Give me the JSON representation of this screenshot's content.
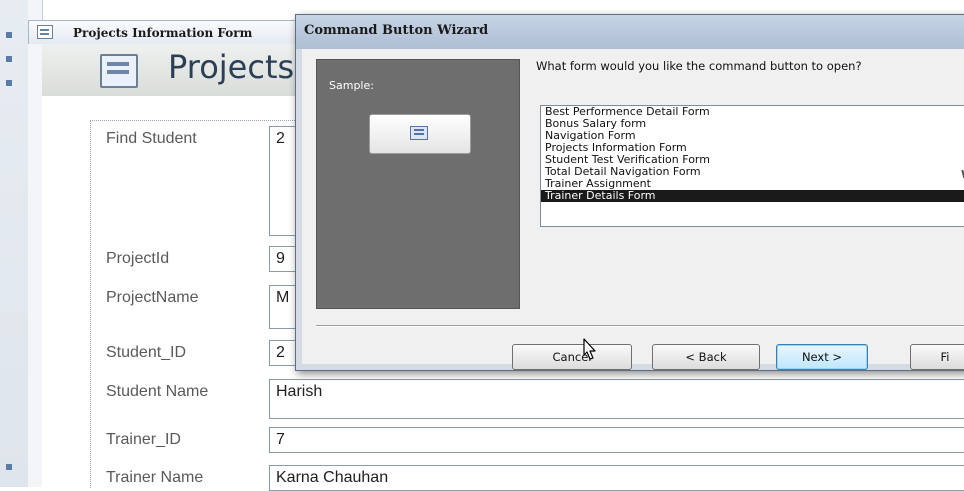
{
  "document_tab": {
    "title": "Projects Information Form"
  },
  "form": {
    "title": "Projects Information Form",
    "fields": [
      {
        "label": "Find Student",
        "value": "2"
      },
      {
        "label": "ProjectId",
        "value": "9"
      },
      {
        "label": "ProjectName",
        "value": "M"
      },
      {
        "label": "Student_ID",
        "value": "2"
      },
      {
        "label": "Student Name",
        "value": "Harish"
      },
      {
        "label": "Trainer_ID",
        "value": "7"
      },
      {
        "label": "Trainer Name",
        "value": "Karna Chauhan"
      }
    ]
  },
  "dialog": {
    "title": "Command Button Wizard",
    "sample_label": "Sample:",
    "question": "What form would you like the command button to open?",
    "hint": "W",
    "forms": [
      "Best Performence Detail Form",
      "Bonus Salary form",
      "Navigation Form",
      "Projects Information Form",
      "Student Test Verification Form",
      "Total Detail Navigation Form",
      "Trainer Assignment",
      "Trainer Details Form"
    ],
    "selected_index": 7,
    "buttons": {
      "cancel": "Cancel",
      "back": "< Back",
      "next": "Next >",
      "finish": "Fi"
    }
  }
}
